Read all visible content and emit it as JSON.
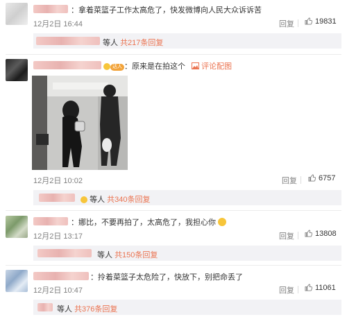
{
  "comments": [
    {
      "text": "拿着菜篮子工作太高危了，快发微博向人民大众诉诉苦",
      "time": "12月2日 16:44",
      "reply": "回复",
      "likes": "19831",
      "sub_deng": "等人",
      "sub_count": "共217条回复"
    },
    {
      "text": "原来是在拍这个",
      "badge": "达人",
      "link_text": "评论配图",
      "time": "12月2日 10:02",
      "reply": "回复",
      "likes": "6757",
      "sub_deng": "等人",
      "sub_count": "共340条回复"
    },
    {
      "text": "娜比，不要再拍了，太高危了，我担心你",
      "time": "12月2日 13:17",
      "reply": "回复",
      "likes": "13808",
      "sub_deng": "等人",
      "sub_count": "共150条回复"
    },
    {
      "text": "拎着菜篮子太危险了，快放下，别把命丢了",
      "time": "12月2日 10:47",
      "reply": "回复",
      "likes": "11061",
      "sub_deng": "等人",
      "sub_count": "共376条回复"
    }
  ],
  "icons": {
    "like": "thumbs-up-icon",
    "photo": "image-icon",
    "emoji": "worried-face-icon"
  },
  "colors": {
    "accent": "#eb7350",
    "muted": "#808080",
    "subbar": "#f2f2f5"
  }
}
